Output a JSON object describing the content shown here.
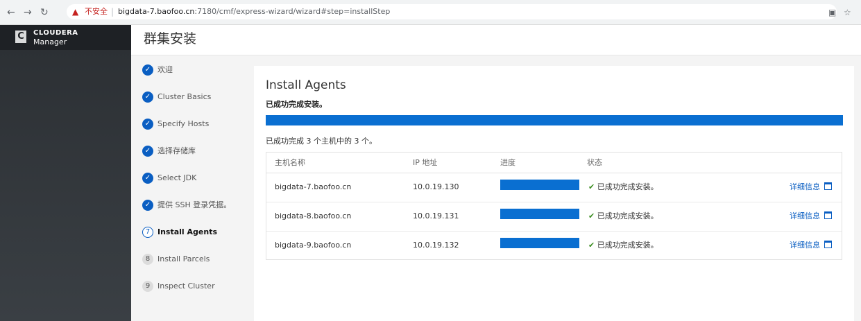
{
  "browser": {
    "security_label": "不安全",
    "url_host": "bigdata-7.baofoo.cn",
    "url_rest": ":7180/cmf/express-wizard/wizard#step=installStep"
  },
  "brand": {
    "top": "CLOUDERA",
    "bottom": "Manager",
    "mark": "C"
  },
  "page": {
    "title": "群集安装"
  },
  "steps": [
    {
      "num": "✓",
      "label": "欢迎",
      "state": "done"
    },
    {
      "num": "✓",
      "label": "Cluster Basics",
      "state": "done"
    },
    {
      "num": "✓",
      "label": "Specify Hosts",
      "state": "done"
    },
    {
      "num": "✓",
      "label": "选择存储库",
      "state": "done"
    },
    {
      "num": "✓",
      "label": "Select JDK",
      "state": "done"
    },
    {
      "num": "✓",
      "label": "提供 SSH 登录凭据。",
      "state": "done"
    },
    {
      "num": "7",
      "label": "Install Agents",
      "state": "current"
    },
    {
      "num": "8",
      "label": "Install Parcels",
      "state": "future"
    },
    {
      "num": "9",
      "label": "Inspect Cluster",
      "state": "future"
    }
  ],
  "main": {
    "title": "Install Agents",
    "status": "已成功完成安装。",
    "progress": 1.0,
    "summary": "已成功完成 3 个主机中的 3 个。",
    "columns": [
      "主机名称",
      "IP 地址",
      "进度",
      "状态"
    ],
    "rows": [
      {
        "host": "bigdata-7.baofoo.cn",
        "ip": "10.0.19.130",
        "progress": 1.0,
        "status": "已成功完成安装。",
        "details": "详细信息"
      },
      {
        "host": "bigdata-8.baofoo.cn",
        "ip": "10.0.19.131",
        "progress": 1.0,
        "status": "已成功完成安装。",
        "details": "详细信息"
      },
      {
        "host": "bigdata-9.baofoo.cn",
        "ip": "10.0.19.132",
        "progress": 1.0,
        "status": "已成功完成安装。",
        "details": "详细信息"
      }
    ]
  },
  "colors": {
    "accent": "#0a5ec2",
    "progress": "#0a6fd1",
    "success": "#3a8c1f",
    "sidebar": "#2b2f33"
  }
}
